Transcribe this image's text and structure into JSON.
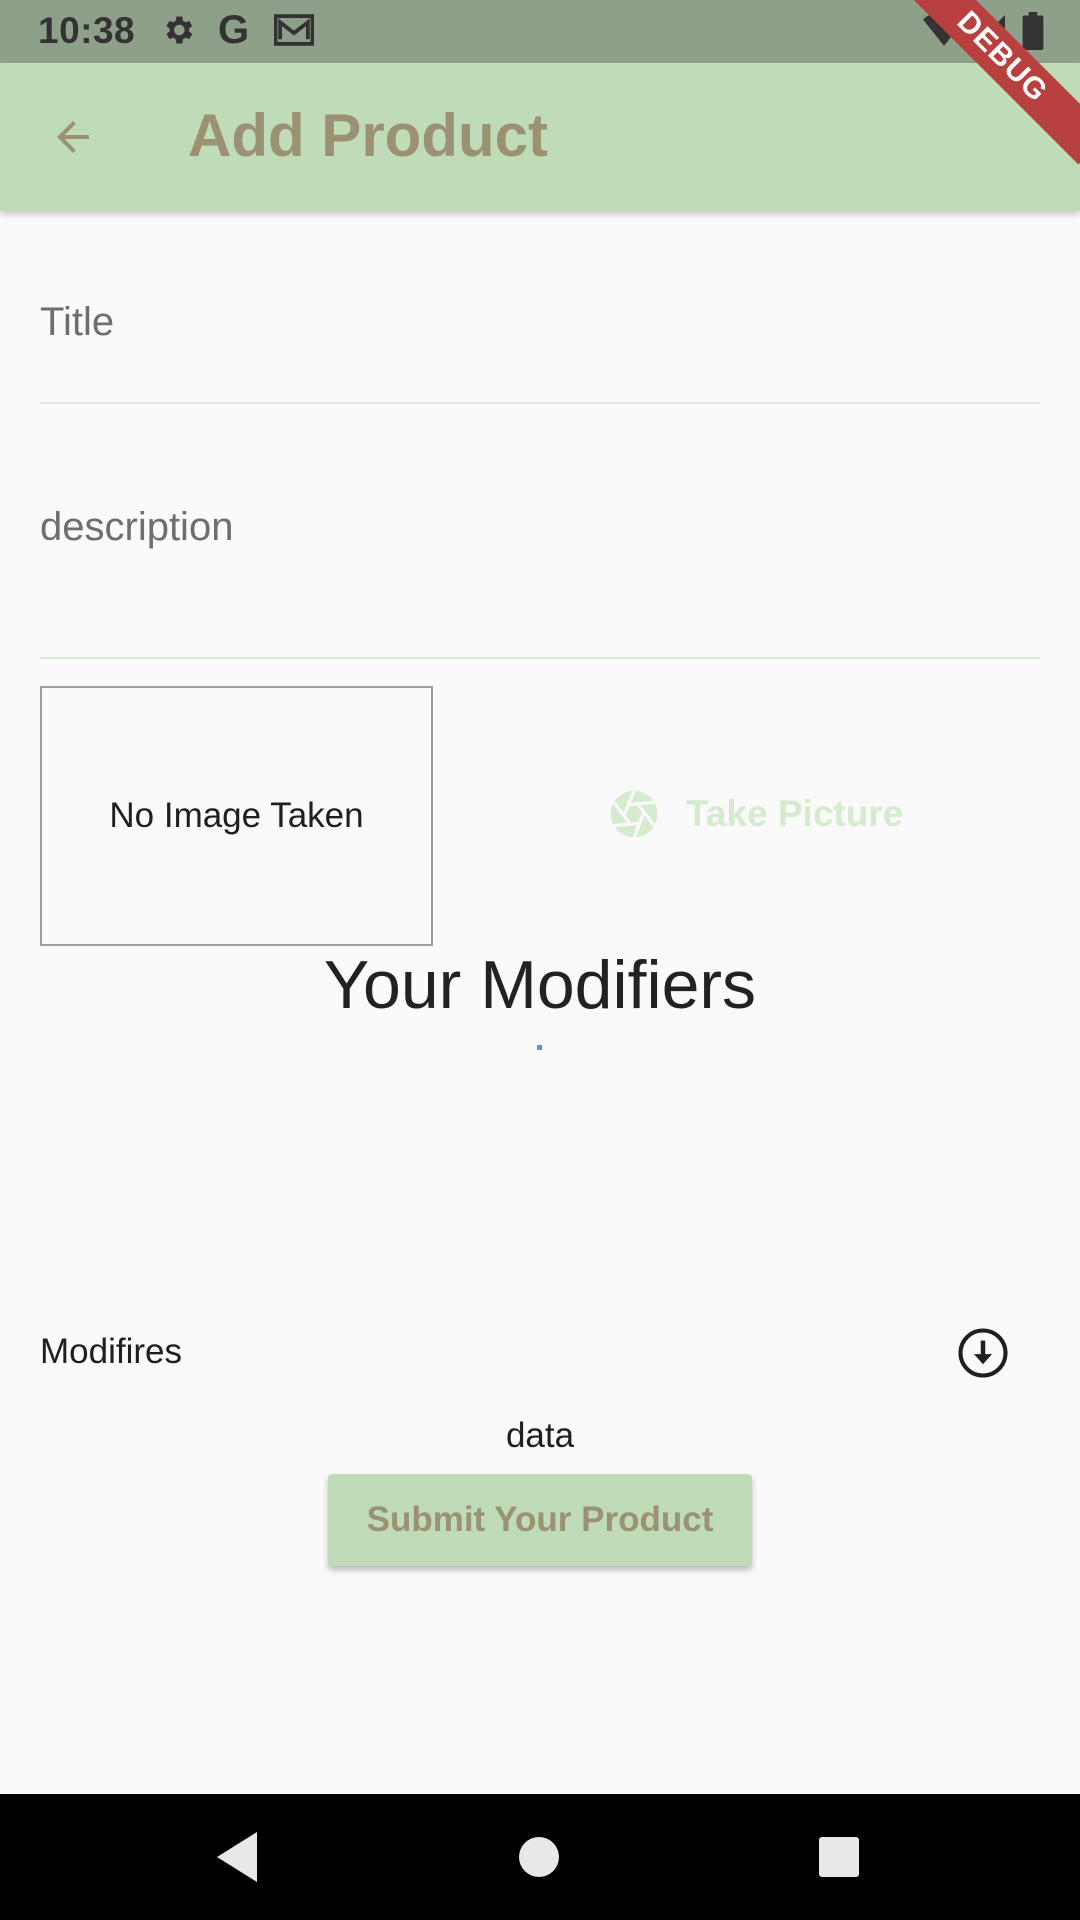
{
  "status_bar": {
    "time": "10:38",
    "icons": [
      "gear-icon",
      "google-icon",
      "mail-icon",
      "wifi-icon",
      "signal-icon",
      "battery-icon"
    ],
    "google_letter": "G"
  },
  "app_bar": {
    "title": "Add Product",
    "back_icon": "arrow-back-icon",
    "debug_label": "DEBUG"
  },
  "form": {
    "title_placeholder": "Title",
    "description_placeholder": "description",
    "image_placeholder": "No Image Taken",
    "take_picture_label": "Take Picture",
    "take_picture_icon": "camera-shutter-icon"
  },
  "modifiers": {
    "heading": "Your Modifiers",
    "dropdown_label": "Modifires",
    "dropdown_icon": "arrow-circle-down-icon",
    "data_text": "data"
  },
  "submit": {
    "label": "Submit Your Product"
  },
  "navigation": {
    "icons": [
      "back-triangle-icon",
      "home-circle-icon",
      "recents-square-icon"
    ]
  },
  "colors": {
    "app_bar": "#c0dbb7",
    "title_text": "#9a9272",
    "take_picture": "#d4ebce",
    "debug_banner": "#b8413f"
  }
}
